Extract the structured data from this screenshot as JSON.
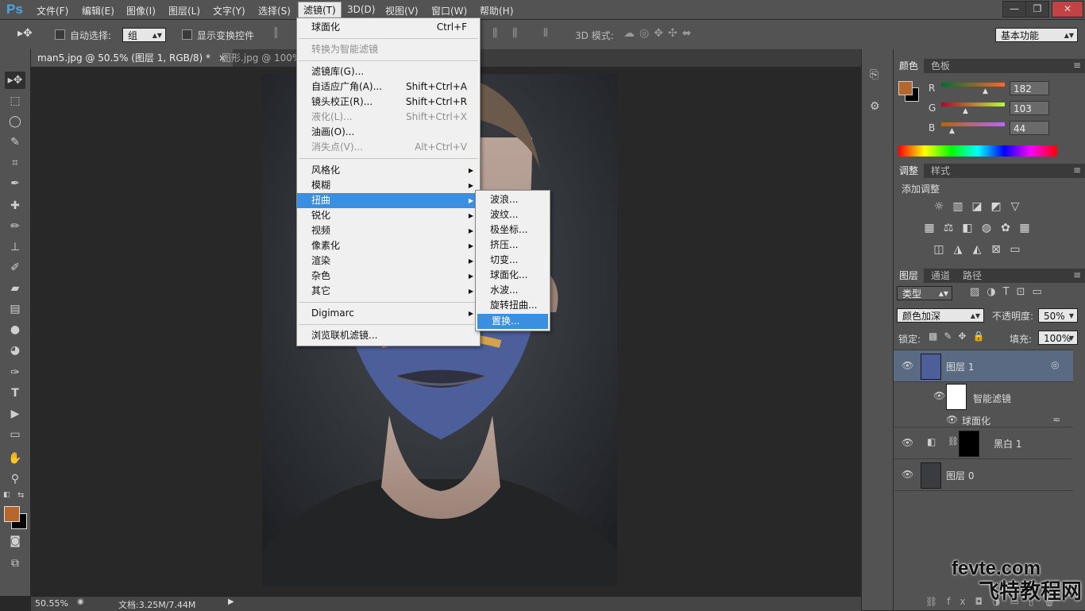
{
  "app": {
    "logo": "Ps"
  },
  "menubar": {
    "items": [
      "文件(F)",
      "编辑(E)",
      "图像(I)",
      "图层(L)",
      "文字(Y)",
      "选择(S)",
      "滤镜(T)",
      "3D(D)",
      "视图(V)",
      "窗口(W)",
      "帮助(H)"
    ]
  },
  "options": {
    "auto_select_label": "自动选择:",
    "auto_select_value": "组",
    "transform_label": "显示变换控件",
    "mode3d_label": "3D 模式:",
    "workspace": "基本功能"
  },
  "tabs": [
    {
      "label": "man5.jpg @ 50.5% (图层 1, RGB/8) *",
      "close": "×"
    },
    {
      "label": "图形.jpg @ 100%"
    }
  ],
  "filter_menu": {
    "items": [
      {
        "label": "球面化",
        "shortcut": "Ctrl+F"
      },
      {
        "label": "转换为智能滤镜",
        "disabled": true
      },
      {
        "label": "滤镜库(G)..."
      },
      {
        "label": "自适应广角(A)...",
        "shortcut": "Shift+Ctrl+A"
      },
      {
        "label": "镜头校正(R)...",
        "shortcut": "Shift+Ctrl+R"
      },
      {
        "label": "液化(L)...",
        "shortcut": "Shift+Ctrl+X",
        "disabled": true
      },
      {
        "label": "油画(O)..."
      },
      {
        "label": "消失点(V)...",
        "shortcut": "Alt+Ctrl+V",
        "disabled": true
      },
      {
        "label": "风格化"
      },
      {
        "label": "模糊"
      },
      {
        "label": "扭曲",
        "highlighted": true
      },
      {
        "label": "锐化"
      },
      {
        "label": "视频"
      },
      {
        "label": "像素化"
      },
      {
        "label": "渲染"
      },
      {
        "label": "杂色"
      },
      {
        "label": "其它"
      },
      {
        "label": "Digimarc"
      },
      {
        "label": "浏览联机滤镜..."
      }
    ]
  },
  "distort_submenu": {
    "items": [
      "波浪...",
      "波纹...",
      "极坐标...",
      "挤压...",
      "切变...",
      "球面化...",
      "水波...",
      "旋转扭曲...",
      "置换..."
    ]
  },
  "status": {
    "zoom": "50.55%",
    "doc": "文档:3.25M/7.44M"
  },
  "color_panel": {
    "tabs": [
      "颜色",
      "色板"
    ],
    "r_label": "R",
    "g_label": "G",
    "b_label": "B",
    "r": "182",
    "g": "103",
    "b": "44",
    "fg_color": "#b6672c",
    "bg_color": "#000000"
  },
  "adjust_panel": {
    "tabs": [
      "调整",
      "样式"
    ],
    "title": "添加调整"
  },
  "layers_panel": {
    "tabs": [
      "图层",
      "通道",
      "路径"
    ],
    "filter_type": "类型",
    "blend_mode": "颜色加深",
    "opacity_label": "不透明度:",
    "opacity": "50%",
    "lock_label": "锁定:",
    "fill_label": "填充:",
    "fill": "100%",
    "layers": [
      {
        "name": "图层 1"
      },
      {
        "name": "智能滤镜"
      },
      {
        "name": "球面化"
      },
      {
        "name": "黑白 1"
      },
      {
        "name": "图层 0"
      }
    ]
  },
  "watermark": {
    "line1": "fevte.com",
    "line2": "飞特教程网"
  }
}
